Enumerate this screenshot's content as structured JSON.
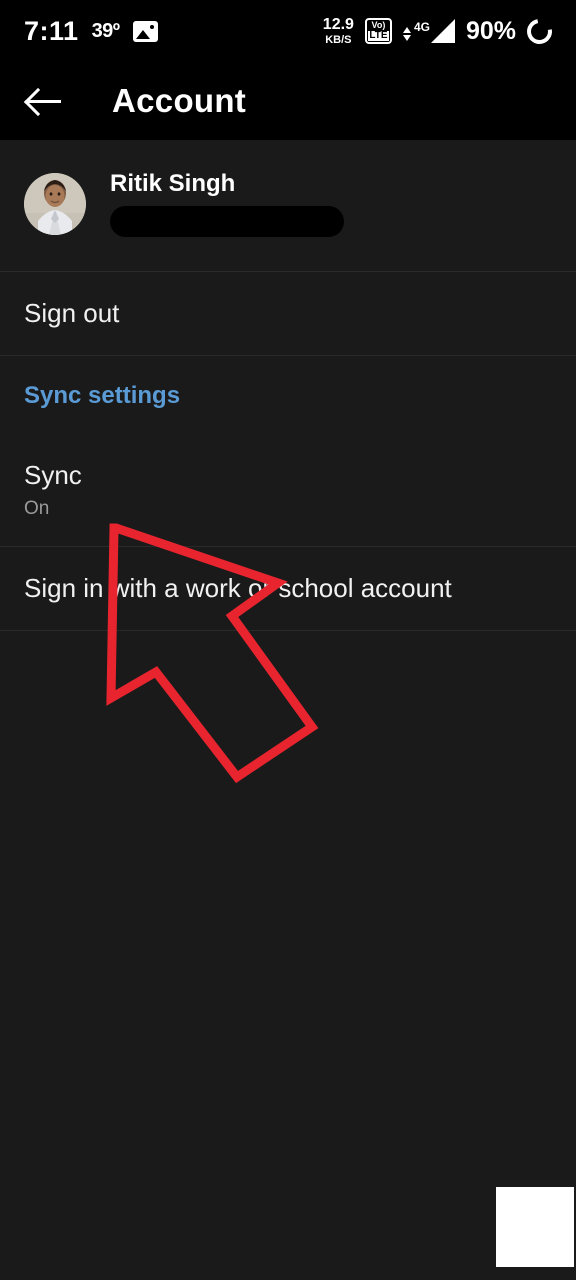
{
  "status_bar": {
    "time": "7:11",
    "temperature": "39º",
    "photo_icon": "image-icon",
    "network_speed_value": "12.9",
    "network_speed_unit": "KB/S",
    "volte_top": "Vo)",
    "volte_bottom": "LTE",
    "network_type": "4G",
    "battery_percent": "90%",
    "battery_icon": "charging-ring-icon"
  },
  "app_bar": {
    "back_icon": "back-arrow-icon",
    "title": "Account"
  },
  "profile": {
    "avatar_icon": "user-avatar-photo",
    "name": "Ritik Singh",
    "email_redacted": ""
  },
  "items": {
    "sign_out": "Sign out",
    "sync_settings_header": "Sync settings",
    "sync_title": "Sync",
    "sync_subtitle": "On",
    "work_account": "Sign in with a work or school account"
  },
  "annotation": {
    "arrow_color": "#e8252f",
    "arrow_direction": "up-left"
  },
  "colors": {
    "accent_blue": "#5b9bd5",
    "app_bar_bg": "#000000",
    "content_bg": "#1a1a1a",
    "text_primary": "#f1f1f1",
    "text_secondary": "#9a9a9a"
  }
}
